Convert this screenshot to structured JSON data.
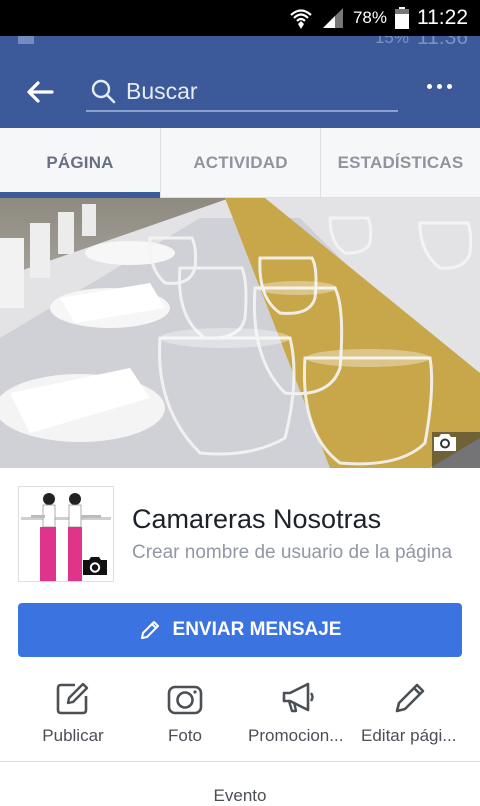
{
  "status": {
    "battery_pct": "78%",
    "time": "11:22"
  },
  "ghost_status": {
    "battery_pct": "15%",
    "time": "11:36"
  },
  "appbar": {
    "search_placeholder": "Buscar"
  },
  "tabs": [
    {
      "label": "PÁGINA",
      "active": true
    },
    {
      "label": "ACTIVIDAD",
      "active": false
    },
    {
      "label": "ESTADÍSTICAS",
      "active": false
    }
  ],
  "page": {
    "name": "Camareras Nosotras",
    "username_prompt": "Crear nombre de usuario de la página"
  },
  "message_button": {
    "label": "ENVIAR MENSAJE",
    "icon": "pencil-icon"
  },
  "actions": [
    {
      "label": "Publicar",
      "icon": "edit-square-icon"
    },
    {
      "label": "Foto",
      "icon": "camera-icon"
    },
    {
      "label": "Promocion...",
      "icon": "megaphone-icon"
    },
    {
      "label": "Editar pági...",
      "icon": "pencil-icon"
    }
  ],
  "next_item": {
    "label": "Evento"
  },
  "colors": {
    "brand": "#3c5a99",
    "button": "#3b74e0",
    "text": "#1d2129",
    "muted": "#9197a3"
  }
}
